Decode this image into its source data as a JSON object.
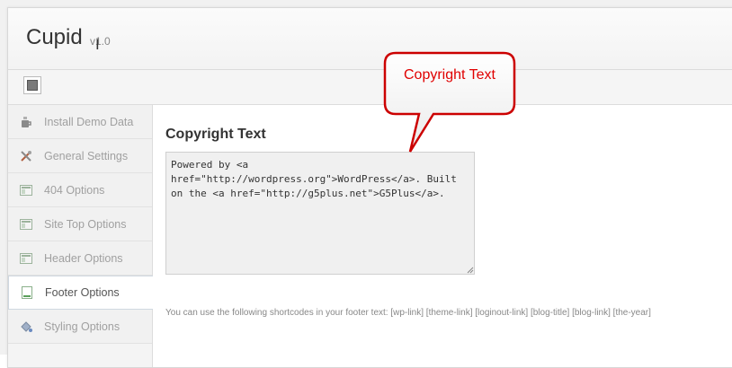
{
  "header": {
    "title": "Cupid",
    "version": "v1.0",
    "cursor_glyph": "I"
  },
  "toolbar": {
    "expand_icon": "expand-collapse-icon"
  },
  "sidebar": {
    "items": [
      {
        "label": "Install Demo Data",
        "icon": "coffee-cup-icon",
        "active": false
      },
      {
        "label": "General Settings",
        "icon": "tools-icon",
        "active": false
      },
      {
        "label": "404 Options",
        "icon": "layout-icon",
        "active": false
      },
      {
        "label": "Site Top Options",
        "icon": "layout-icon",
        "active": false
      },
      {
        "label": "Header Options",
        "icon": "layout-icon",
        "active": false
      },
      {
        "label": "Footer Options",
        "icon": "footer-layout-icon",
        "active": true
      },
      {
        "label": "Styling Options",
        "icon": "paint-bucket-icon",
        "active": false
      }
    ]
  },
  "main": {
    "section_title": "Copyright Text",
    "copyright_value": "Powered by <a href=\"http://wordpress.org\">WordPress</a>. Built on the <a href=\"http://g5plus.net\">G5Plus</a>.",
    "help_text": "You can use the following shortcodes in your footer text: [wp-link] [theme-link] [loginout-link] [blog-title] [blog-link] [the-year]"
  },
  "callout": {
    "label": "Copyright Text",
    "text_color": "#e00000",
    "border_color": "#cc0000"
  }
}
